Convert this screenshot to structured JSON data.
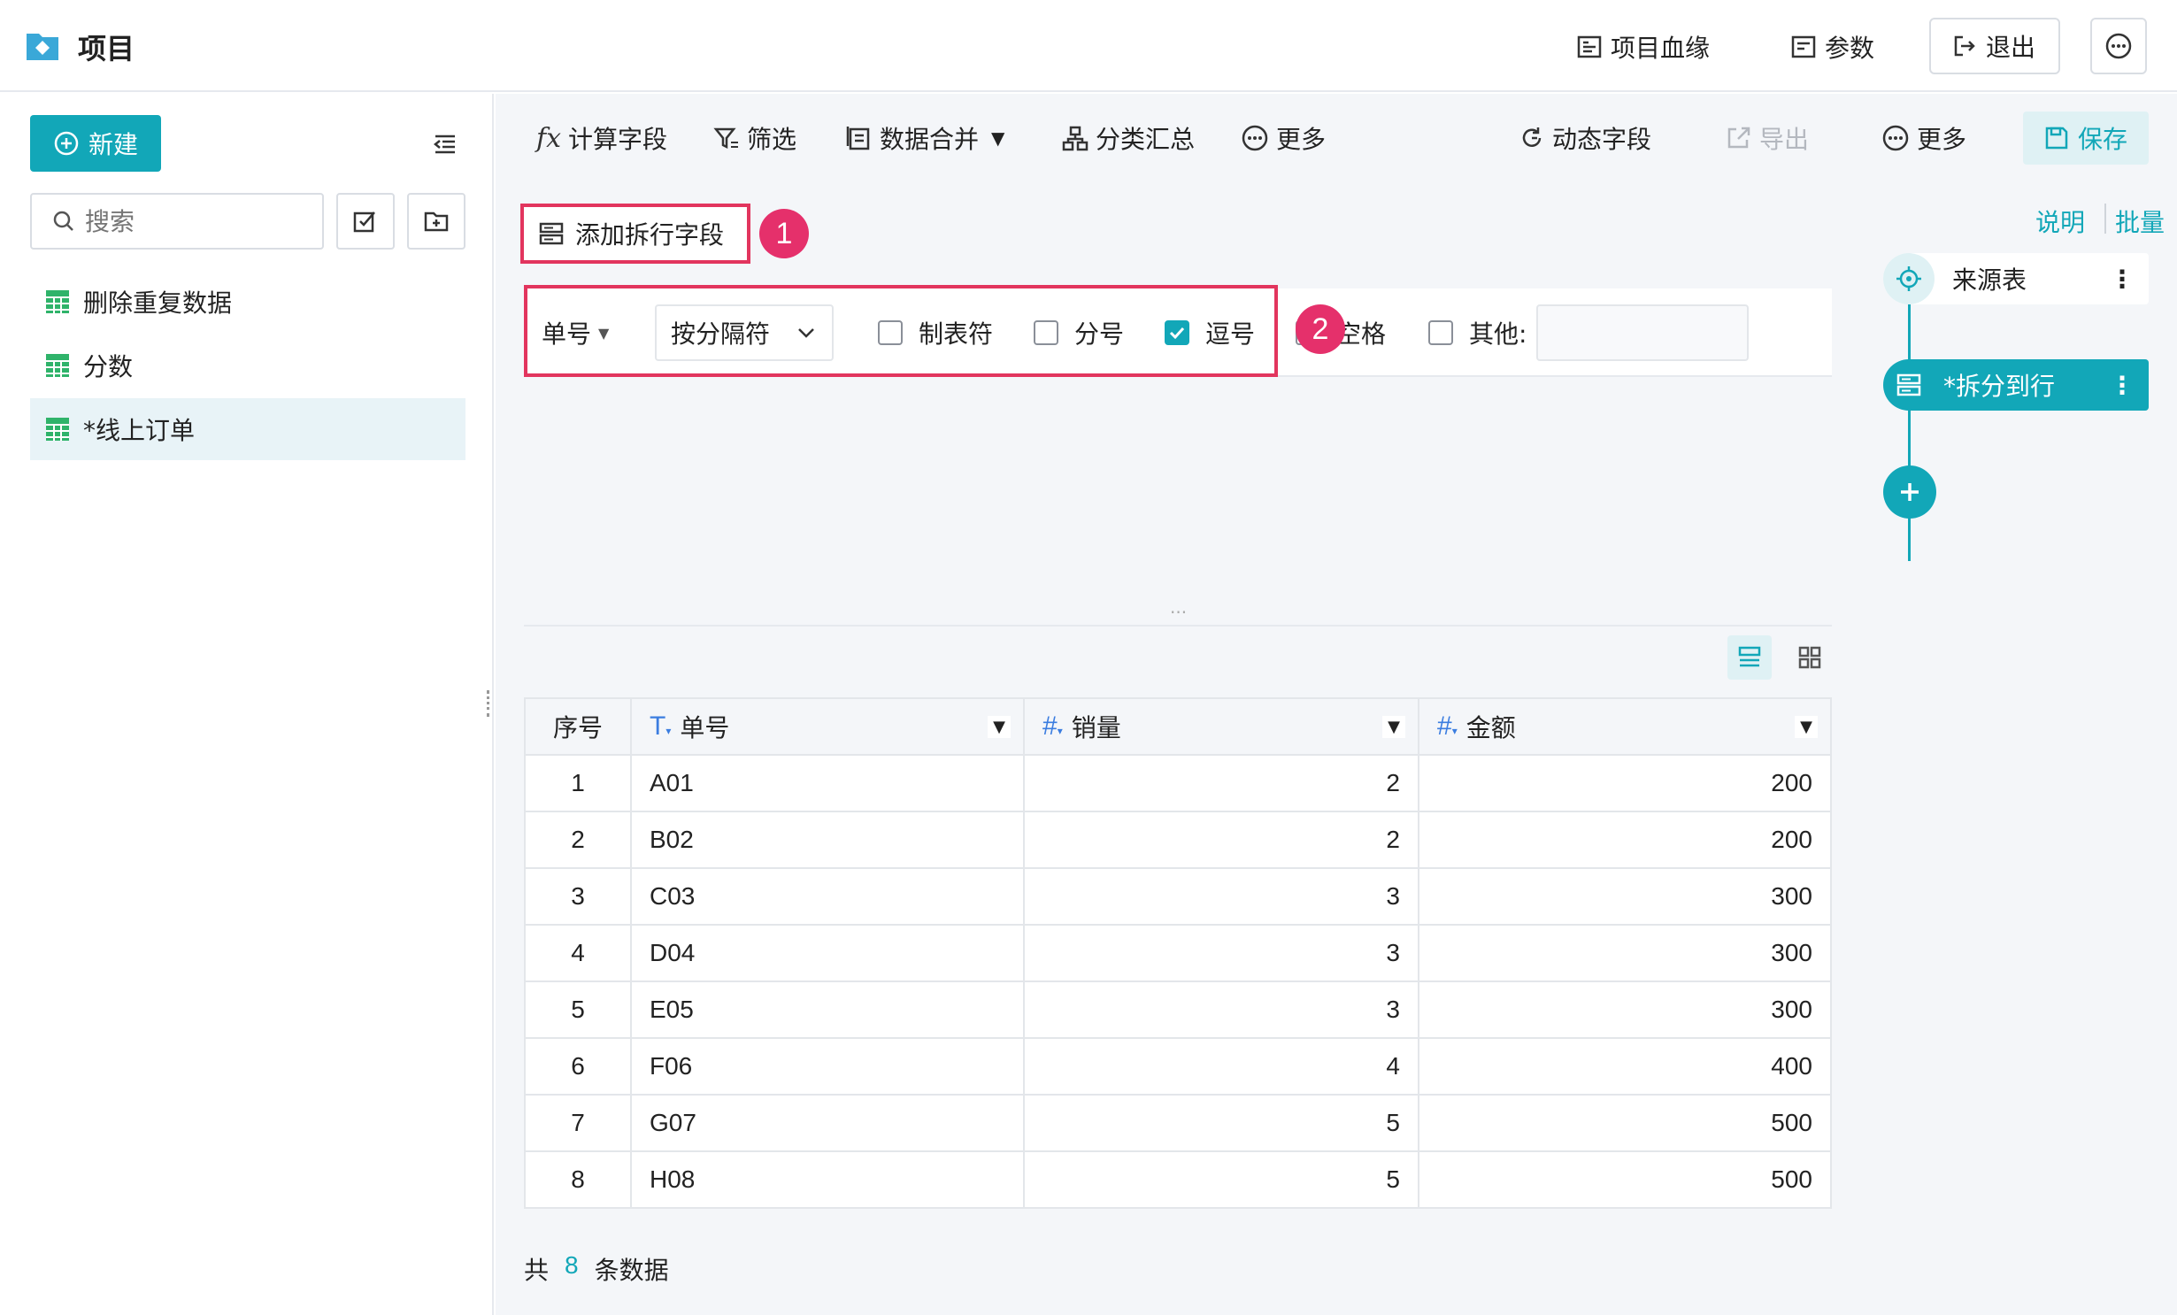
{
  "header": {
    "title": "项目",
    "lineage": "项目血缘",
    "params": "参数",
    "logout": "退出"
  },
  "sidebar": {
    "new_label": "新建",
    "search_placeholder": "搜索",
    "items": [
      {
        "label": "删除重复数据"
      },
      {
        "label": "分数"
      },
      {
        "label": "*线上订单"
      }
    ]
  },
  "toolbar": {
    "calc_field": "计算字段",
    "filter": "筛选",
    "merge": "数据合并",
    "group_summary": "分类汇总",
    "more1": "更多",
    "dynamic_field": "动态字段",
    "export": "导出",
    "more2": "更多",
    "save": "保存"
  },
  "step": {
    "add_split_field": "添加拆行字段",
    "badge1": "1",
    "badge2": "2",
    "field_name": "单号",
    "split_mode": "按分隔符",
    "options": [
      {
        "label": "制表符",
        "checked": false
      },
      {
        "label": "分号",
        "checked": false
      },
      {
        "label": "逗号",
        "checked": true
      },
      {
        "label": "空格",
        "checked": false
      },
      {
        "label": "其他:",
        "checked": false
      }
    ],
    "ellipsis": "..."
  },
  "table": {
    "headers": [
      "序号",
      "单号",
      "销量",
      "金额"
    ],
    "rows": [
      [
        "1",
        "A01",
        "2",
        "200"
      ],
      [
        "2",
        "B02",
        "2",
        "200"
      ],
      [
        "3",
        "C03",
        "3",
        "300"
      ],
      [
        "4",
        "D04",
        "3",
        "300"
      ],
      [
        "5",
        "E05",
        "3",
        "300"
      ],
      [
        "6",
        "F06",
        "4",
        "400"
      ],
      [
        "7",
        "G07",
        "5",
        "500"
      ],
      [
        "8",
        "H08",
        "5",
        "500"
      ]
    ]
  },
  "footer": {
    "prefix": "共",
    "count": "8",
    "suffix": "条数据"
  },
  "right_panel": {
    "explain": "说明",
    "batch": "批量",
    "nodes": [
      {
        "label": "来源表"
      },
      {
        "label": "*拆分到行"
      }
    ]
  },
  "colors": {
    "accent": "#12a7b8",
    "highlight_red": "#e2355e"
  }
}
